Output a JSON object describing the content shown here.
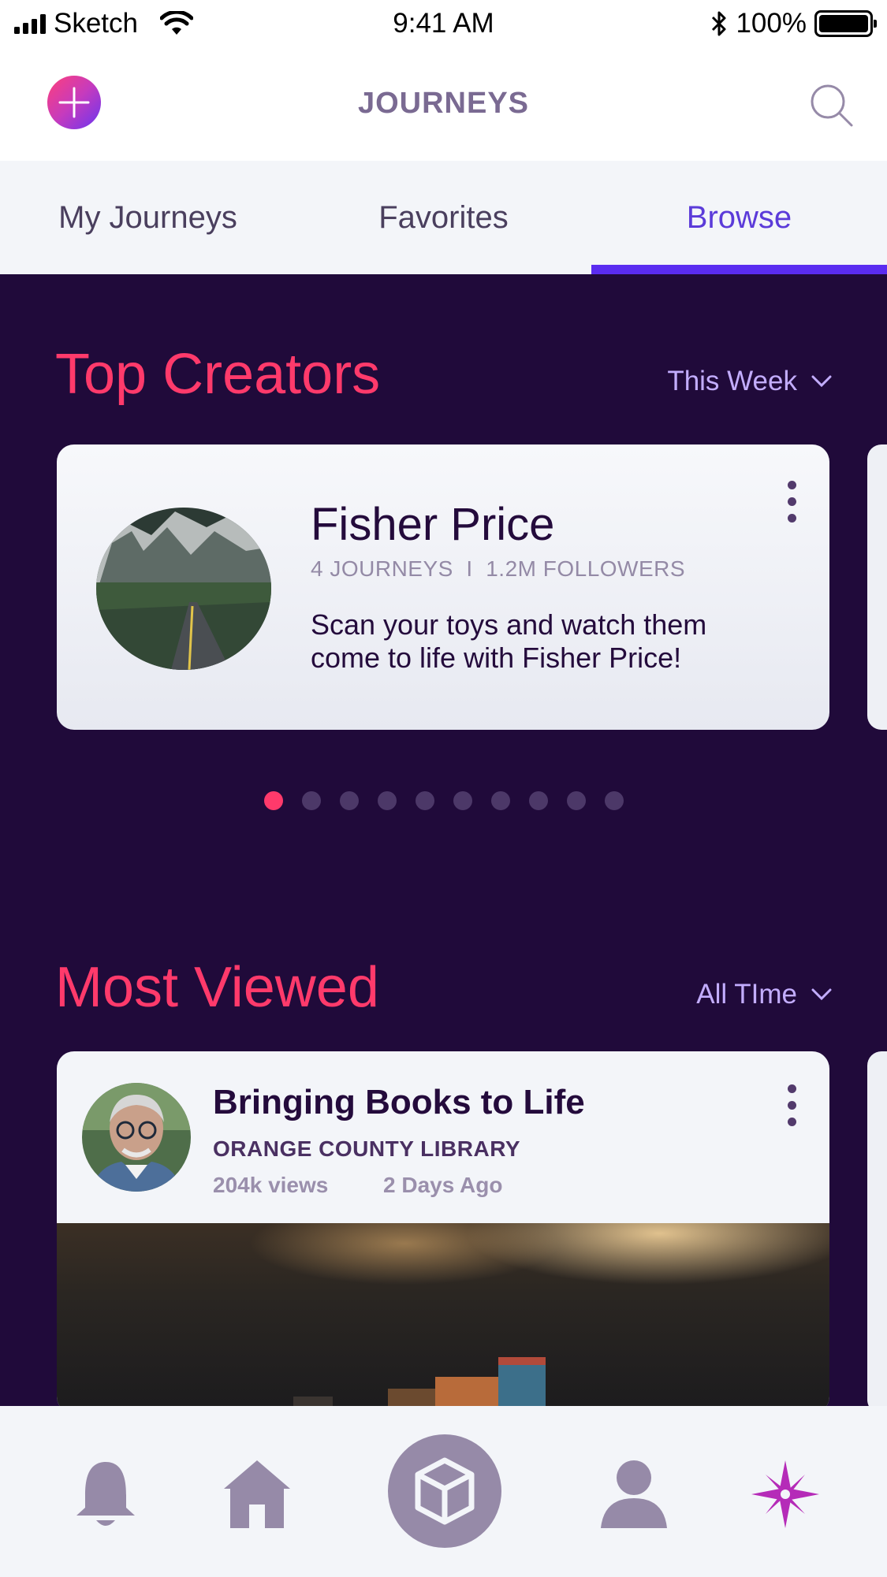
{
  "status_bar": {
    "carrier": "Sketch",
    "time": "9:41 AM",
    "battery": "100%"
  },
  "header": {
    "title": "JOURNEYS"
  },
  "tabs": [
    {
      "label": "My Journeys",
      "active": false
    },
    {
      "label": "Favorites",
      "active": false
    },
    {
      "label": "Browse",
      "active": true
    }
  ],
  "top_creators": {
    "title": "Top Creators",
    "filter": "This Week",
    "card": {
      "name": "Fisher Price",
      "stats": "4 JOURNEYS  I  1.2M FOLLOWERS",
      "description": "Scan your toys and watch them come to life with Fisher Price!"
    },
    "pagination": {
      "total": 10,
      "active_index": 0
    }
  },
  "most_viewed": {
    "title": "Most Viewed",
    "filter": "All TIme",
    "card": {
      "title": "Bringing Books to Life",
      "org": "ORANGE COUNTY LIBRARY",
      "views": "204k views",
      "time": "2 Days Ago"
    }
  },
  "bottom_nav": {
    "items": [
      "bell-icon",
      "home-icon",
      "cube-icon",
      "profile-icon",
      "compass-icon"
    ],
    "active": "compass-icon"
  },
  "colors": {
    "accent": "#5a2cf0",
    "section_title": "#ff3a6b",
    "background_dark": "#200a3a",
    "icon_muted": "#968aa8",
    "nav_active": "#b52bb8"
  }
}
